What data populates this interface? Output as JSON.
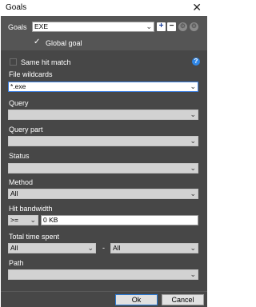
{
  "window": {
    "title": "Goals",
    "close_glyph": "✕"
  },
  "goals": {
    "label": "Goals",
    "selected": "EXE",
    "global_goal": {
      "label": "Global goal",
      "checked": true
    }
  },
  "options": {
    "same_hit_match": {
      "label": "Same hit match",
      "checked": false
    }
  },
  "fields": {
    "file_wildcards": {
      "label": "File wildcards",
      "value": "*.exe"
    },
    "query": {
      "label": "Query",
      "value": ""
    },
    "query_part": {
      "label": "Query part",
      "value": ""
    },
    "status": {
      "label": "Status",
      "value": ""
    },
    "method": {
      "label": "Method",
      "value": "All"
    },
    "hit_bandwidth": {
      "label": "Hit bandwidth",
      "operator": ">=",
      "value": "0 KB"
    },
    "total_time_spent": {
      "label": "Total time spent",
      "from": "All",
      "separator": "-",
      "to": "All"
    },
    "path": {
      "label": "Path",
      "value": ""
    }
  },
  "buttons": {
    "ok": "Ok",
    "cancel": "Cancel"
  },
  "icons": {
    "dropdown": "chevron-down-icon",
    "add": "plus-icon",
    "remove": "minus-icon",
    "settings": "gear-icon",
    "help": "help-icon",
    "check": "checkmark-icon"
  },
  "colors": {
    "accent": "#2f86e6",
    "panel": "#474747",
    "header": "#555555"
  }
}
